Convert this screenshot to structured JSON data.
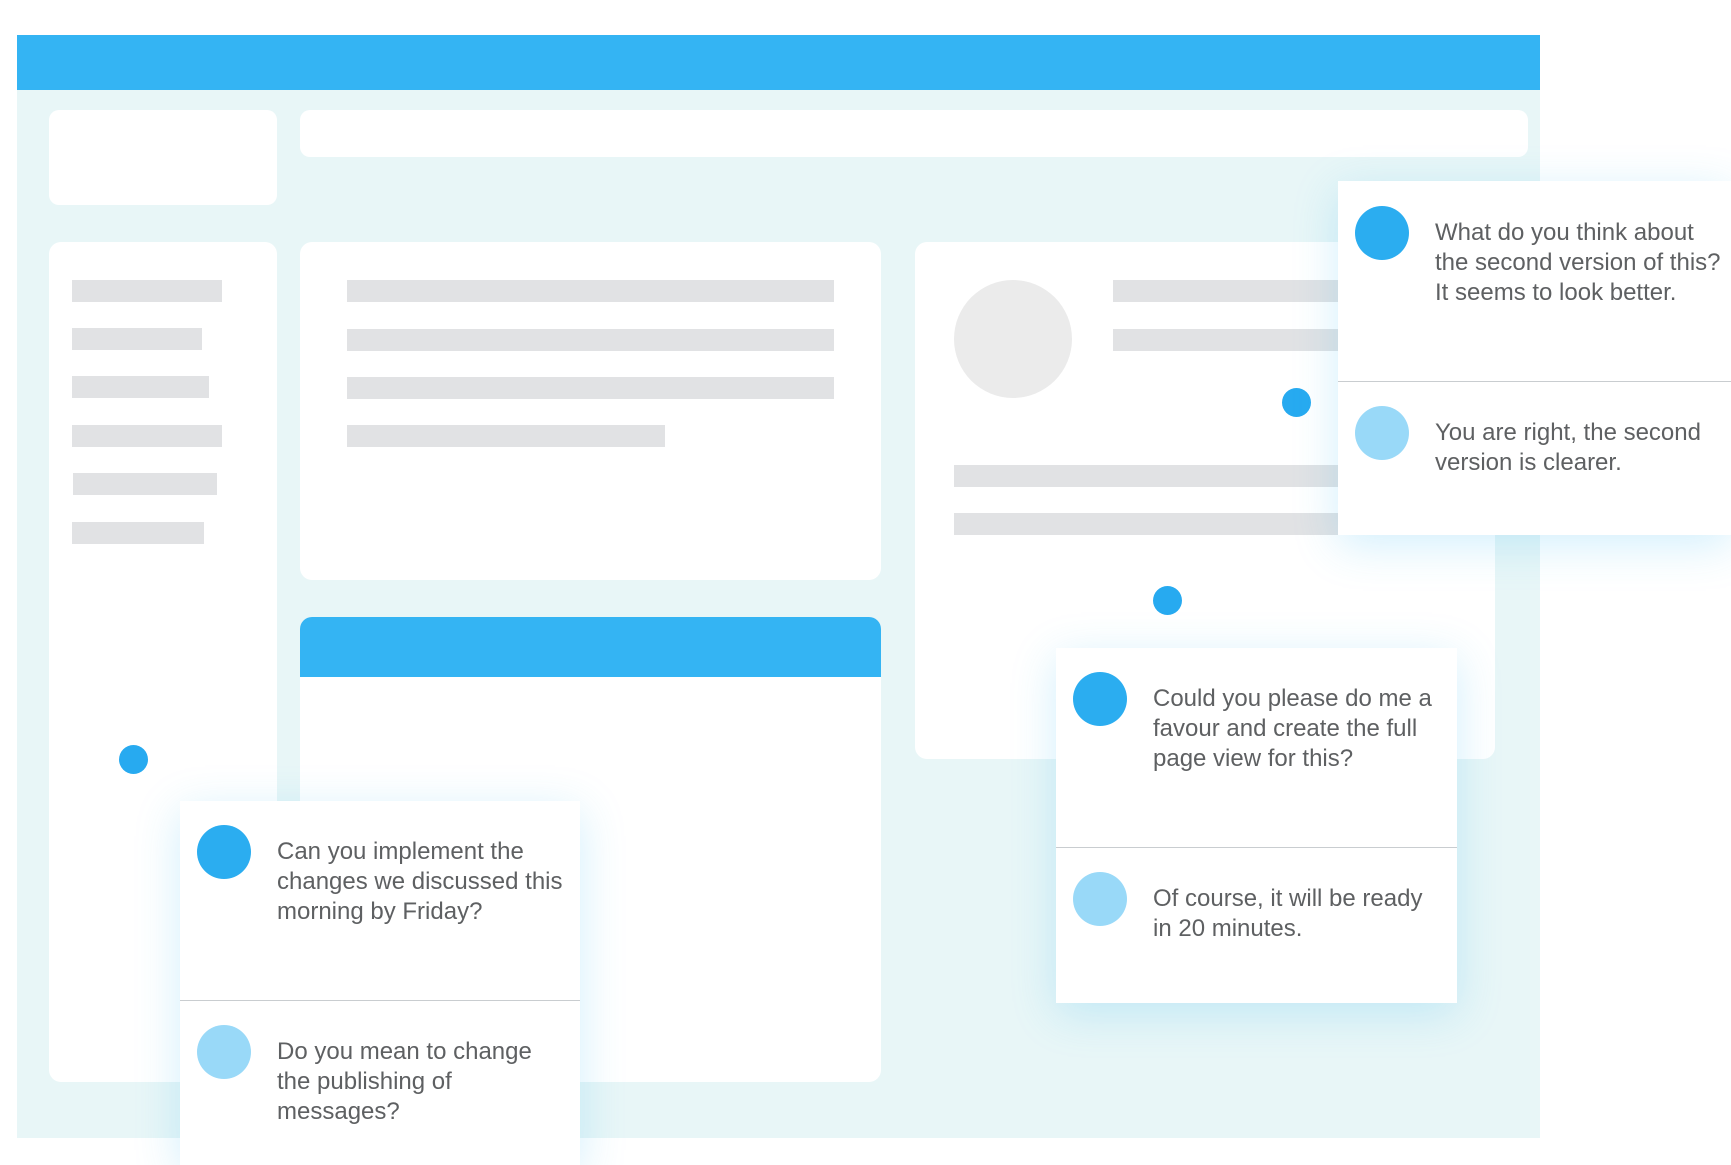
{
  "colors": {
    "accent": "#34b4f3",
    "window_background": "#e8f6f7",
    "card_background": "#ffffff",
    "placeholder": "#e1e2e4",
    "avatar_primary": "#2badf0",
    "avatar_secondary": "#99d9f8",
    "message_text": "#5e6062"
  },
  "chats": {
    "top_right": {
      "question": "What do you think about the second version of this? It seems to look better.",
      "reply": "You are right, the second version is clearer."
    },
    "middle_right": {
      "question": "Could you please do me a favour and create the full page view for this?",
      "reply": "Of course, it will be ready in 20 minutes."
    },
    "bottom_left": {
      "question": "Can you implement the changes we discussed this morning by Friday?",
      "reply": "Do you mean to change the publishing of messages?"
    }
  }
}
